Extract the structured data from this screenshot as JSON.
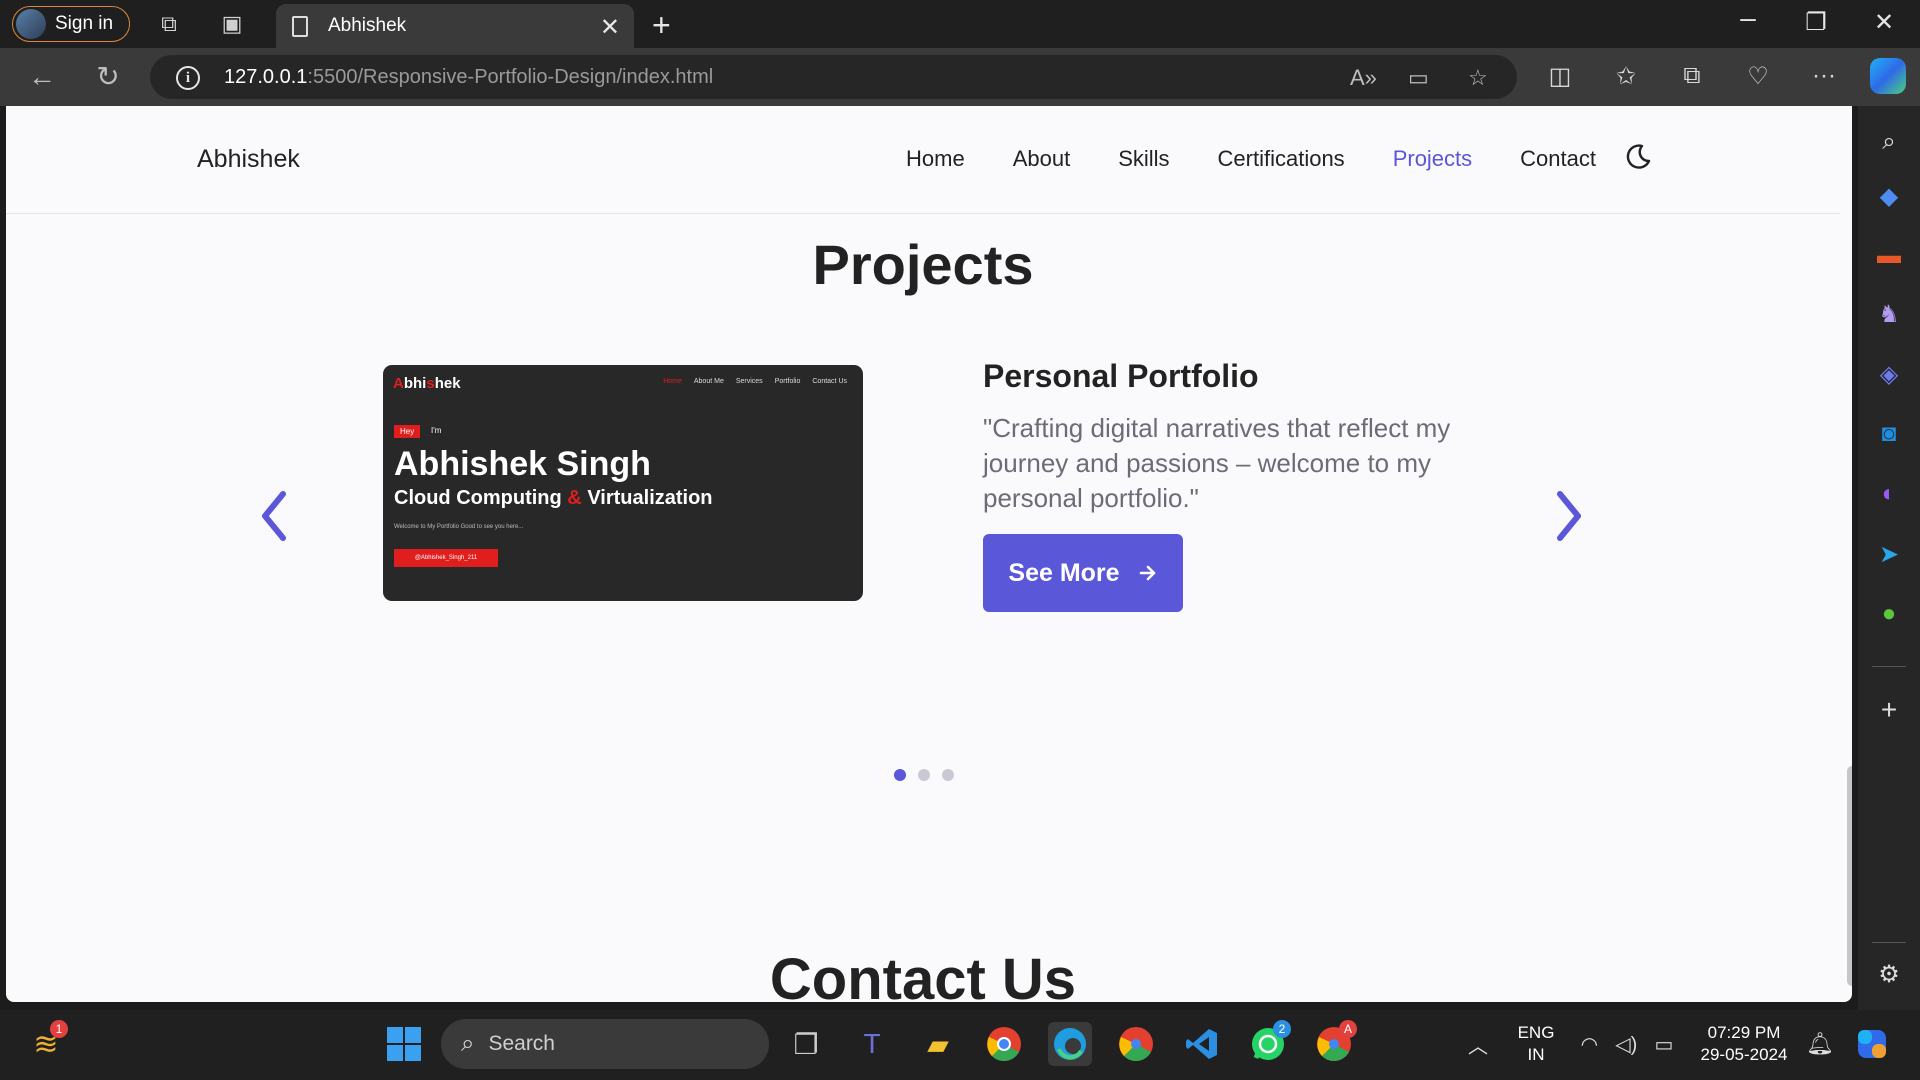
{
  "browser": {
    "sign_in": "Sign in",
    "tab_title": "Abhishek",
    "url_host": "127.0.0.1",
    "url_path": ":5500/Responsive-Portfolio-Design/index.html"
  },
  "site": {
    "logo": "Abhishek",
    "nav": [
      "Home",
      "About",
      "Skills",
      "Certifications",
      "Projects",
      "Contact"
    ],
    "active_nav": "Projects",
    "accent_color": "#5a57d9"
  },
  "projects": {
    "section_title": "Projects",
    "title": "Personal Portfolio",
    "description": "\"Crafting digital narratives that reflect my journey and passions – welcome to my personal portfolio.\"",
    "button": "See More",
    "slides_total": 3,
    "active_slide": 1,
    "preview": {
      "logo_a": "A",
      "logo_mid": "bhi",
      "logo_s": "s",
      "logo_end": "hek",
      "menu": [
        "Home",
        "About Me",
        "Services",
        "Portfolio",
        "Contact Us"
      ],
      "hey": "Hey",
      "im": "I'm",
      "name": "Abhishek Singh",
      "subtitle_a": "Cloud Computing",
      "subtitle_amp": "&",
      "subtitle_b": "Virtualization",
      "welcome": "Welcome to My Portfolio Good to see you here...",
      "handle": "@Abhishek_Singh_211"
    }
  },
  "contact": {
    "section_title": "Contact Us"
  },
  "taskbar": {
    "search": "Search",
    "lang_top": "ENG",
    "lang_bottom": "IN",
    "time": "07:29 PM",
    "date": "29-05-2024",
    "notif_count": "1",
    "whatsapp_badge": "2",
    "chrome_badge": "A"
  }
}
